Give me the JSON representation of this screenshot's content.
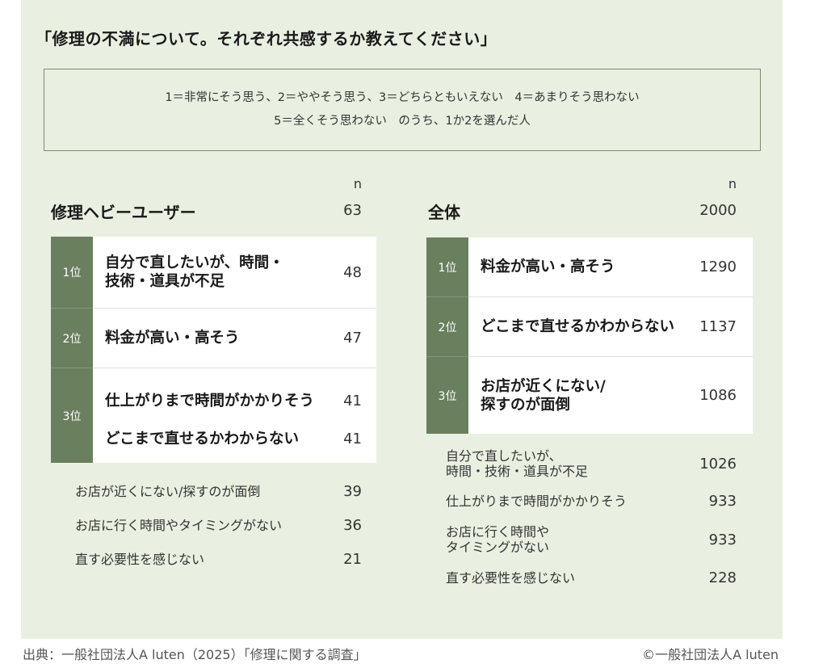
{
  "title": "「修理の不満について。それぞれ共感するか教えてください」",
  "scale_note": {
    "line1": "1＝非常にそう思う、2＝ややそう思う、3＝どちらともいえない　4＝あまりそう思わない",
    "line2": "5＝全くそう思わない　のうち、1か2を選んだ人"
  },
  "n_header": "n",
  "source": "出典：一般社団法人A luten（2025）「修理に関する調査」",
  "copyright": "©一般社団法人A luten",
  "colors": {
    "background": "#e9f0e1",
    "rank_fill": "#6a7f5e",
    "card": "#ffffff",
    "text": "#1a1a1a"
  },
  "chart_data": [
    {
      "type": "table",
      "group": "修理ヘビーユーザー",
      "n": 63,
      "ranked": [
        {
          "rank": "1位",
          "rows": [
            {
              "label": "自分で直したいが、時間・\n技術・道具が不足",
              "value": 48
            }
          ]
        },
        {
          "rank": "2位",
          "rows": [
            {
              "label": "料金が高い・高そう",
              "value": 47
            }
          ]
        },
        {
          "rank": "3位",
          "rows": [
            {
              "label": "仕上がりまで時間がかかりそう",
              "value": 41
            },
            {
              "label": "どこまで直せるかわからない",
              "value": 41
            }
          ]
        }
      ],
      "others": [
        {
          "label": "お店が近くにない/探すのが面倒",
          "value": 39
        },
        {
          "label": "お店に行く時間やタイミングがない",
          "value": 36
        },
        {
          "label": "直す必要性を感じない",
          "value": 21
        }
      ]
    },
    {
      "type": "table",
      "group": "全体",
      "n": 2000,
      "ranked": [
        {
          "rank": "1位",
          "rows": [
            {
              "label": "料金が高い・高そう",
              "value": 1290
            }
          ]
        },
        {
          "rank": "2位",
          "rows": [
            {
              "label": "どこまで直せるかわからない",
              "value": 1137
            }
          ]
        },
        {
          "rank": "3位",
          "rows": [
            {
              "label": "お店が近くにない/\n探すのが面倒",
              "value": 1086
            }
          ]
        }
      ],
      "others": [
        {
          "label": "自分で直したいが、\n時間・技術・道具が不足",
          "value": 1026
        },
        {
          "label": "仕上がりまで時間がかかりそう",
          "value": 933
        },
        {
          "label": "お店に行く時間や\nタイミングがない",
          "value": 933
        },
        {
          "label": "直す必要性を感じない",
          "value": 228
        }
      ]
    }
  ]
}
